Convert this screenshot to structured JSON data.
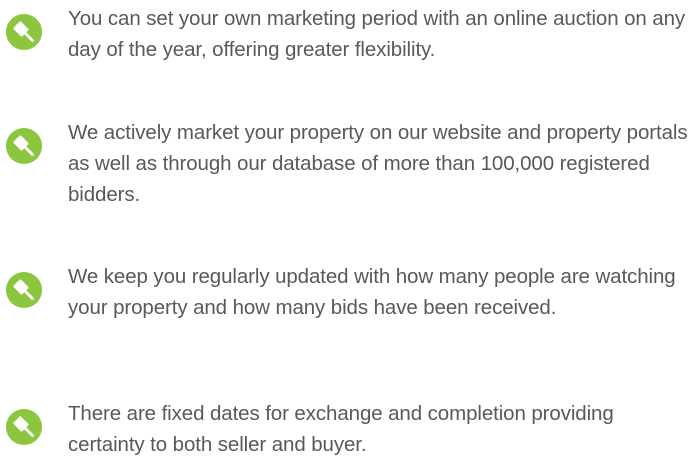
{
  "accent_color": "#8cc63f",
  "text_color": "#58595b",
  "benefits": [
    {
      "icon": "auction-gavel-icon",
      "text": "You can set your own marketing period with an online auction on any day of the year, offering greater flexibility."
    },
    {
      "icon": "auction-gavel-icon",
      "text": "We actively market your property on our website and property portals as well as through our database of more than 100,000 registered bidders."
    },
    {
      "icon": "auction-gavel-icon",
      "text": "We keep you regularly updated with how many people are watching your property and how many bids have been received."
    },
    {
      "icon": "auction-gavel-icon",
      "text": "There are fixed dates for exchange and completion providing certainty to both seller and buyer."
    }
  ]
}
